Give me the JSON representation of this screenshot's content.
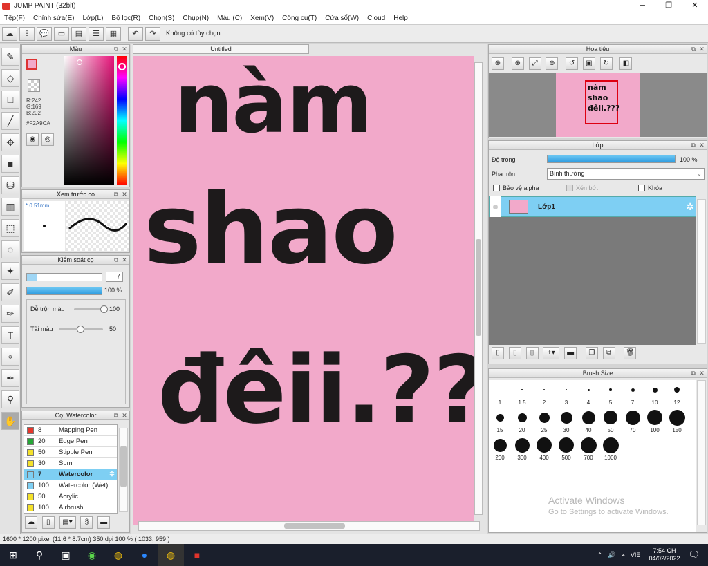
{
  "window": {
    "title": "JUMP PAINT (32bit)"
  },
  "menu": [
    "Tệp(F)",
    "Chỉnh sửa(E)",
    "Lớp(L)",
    "Bộ lọc(R)",
    "Chọn(S)",
    "Chụp(N)",
    "Màu (C)",
    "Xem(V)",
    "Công cụ(T)",
    "Cửa sổ(W)",
    "Cloud",
    "Help"
  ],
  "toolbar": {
    "selection_label": "Không có tùy chọn"
  },
  "color_panel": {
    "title": "Màu",
    "r": "R:242",
    "g": "G:169",
    "b": "B:202",
    "hex": "#F2A9CA",
    "fg_color": "#f2a9ca"
  },
  "preview_panel": {
    "title": "Xem trước cọ",
    "size": "0.51mm"
  },
  "brush_control": {
    "title": "Kiểm soát cọ",
    "size_value": "7",
    "opacity": "100 %",
    "blend_label": "Dễ trộn màu",
    "blend_value": "100",
    "blend_level": 1.0,
    "flow_label": "Tải màu",
    "flow_value": "50",
    "flow_level": 0.5
  },
  "brush_list": {
    "title": "Cọ: Watercolor",
    "items": [
      {
        "size": "8",
        "name": "Mapping Pen",
        "color": "#e8362b"
      },
      {
        "size": "20",
        "name": "Edge Pen",
        "color": "#25a736"
      },
      {
        "size": "50",
        "name": "Stipple Pen",
        "color": "#f4e12b"
      },
      {
        "size": "30",
        "name": "Sumi",
        "color": "#f4e12b"
      },
      {
        "size": "7",
        "name": "Watercolor",
        "color": "#7ecff3"
      },
      {
        "size": "100",
        "name": "Watercolor (Wet)",
        "color": "#7ecff3"
      },
      {
        "size": "50",
        "name": "Acrylic",
        "color": "#f4e12b"
      },
      {
        "size": "100",
        "name": "Airbrush",
        "color": "#f4e12b"
      }
    ]
  },
  "canvas": {
    "tab": "Untitled",
    "bg_color": "#f2a9ca",
    "line1": "nàm",
    "line2": "shao",
    "line3": "đêii.???"
  },
  "navigator": {
    "title": "Hoa tiêu",
    "thumb_text": "nàm shao đêii.???"
  },
  "layer_panel": {
    "title": "Lớp",
    "opacity_label": "Độ trong",
    "opacity_value": "100 %",
    "opacity_level": 1.0,
    "blend_label": "Pha trộn",
    "blend_value": "Bình thường",
    "protect_alpha": "Bảo vệ alpha",
    "clip": "Xén bớt",
    "lock": "Khóa",
    "layer_name": "Lớp1"
  },
  "brush_size": {
    "title": "Brush Size",
    "sizes": [
      "1",
      "1.5",
      "2",
      "3",
      "4",
      "5",
      "7",
      "10",
      "12",
      "15",
      "20",
      "25",
      "30",
      "40",
      "50",
      "70",
      "100",
      "150",
      "200",
      "300",
      "400",
      "500",
      "700",
      "1000"
    ]
  },
  "activate": {
    "title": "Activate Windows",
    "sub": "Go to Settings to activate Windows."
  },
  "status": {
    "text": "1600 * 1200 pixel   (11.6 * 8.7cm)   350 dpi   100 %   ( 1033, 959 )"
  },
  "taskbar": {
    "lang": "VIE",
    "time": "7:54 CH",
    "date": "04/02/2022"
  }
}
